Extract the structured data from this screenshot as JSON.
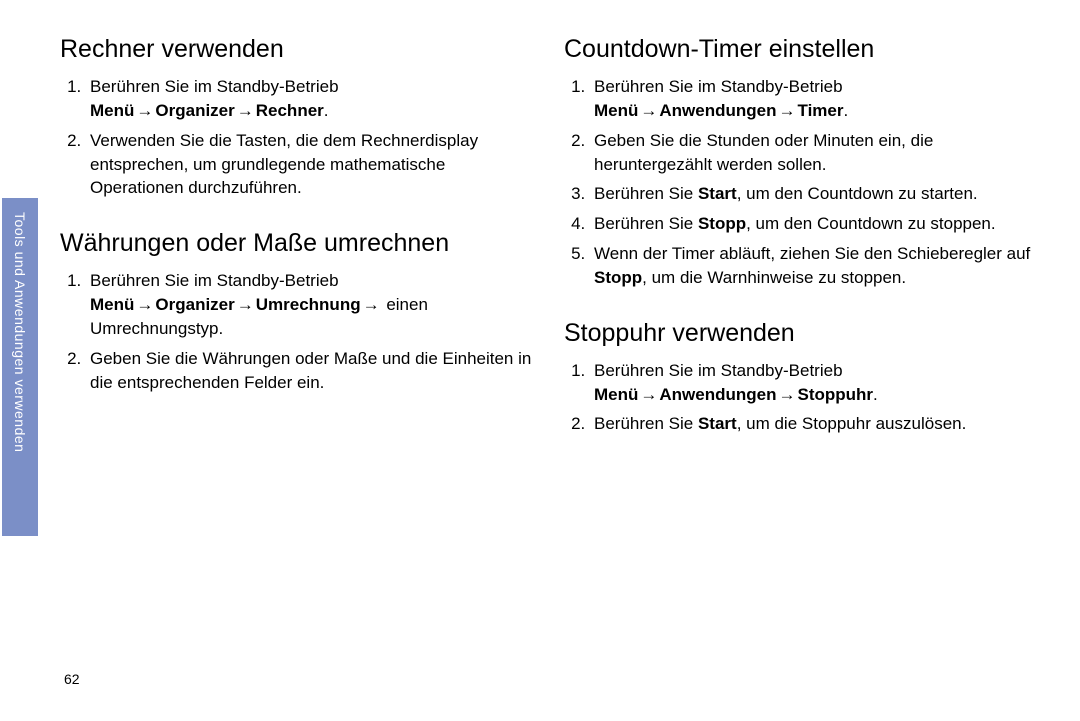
{
  "sidebar": {
    "label": "Tools und Anwendungen verwenden"
  },
  "page_number": "62",
  "arrow": "→",
  "left": {
    "section1": {
      "heading": "Rechner verwenden",
      "item1": {
        "pre": "Berühren Sie im Standby-Betrieb ",
        "b1": "Menü",
        "b2": "Organizer",
        "b3": "Rechner",
        "end": "."
      },
      "item2": "Verwenden Sie die Tasten, die dem Rechnerdisplay entsprechen, um grundlegende mathematische Operationen durchzuführen."
    },
    "section2": {
      "heading": "Währungen oder Maße umrechnen",
      "item1": {
        "pre": "Berühren Sie im Standby-Betrieb ",
        "b1": "Menü",
        "b2": "Organizer",
        "b3": "Umrechnung",
        "post": " einen Umrechnungstyp."
      },
      "item2": "Geben Sie die Währungen oder Maße und die Einheiten in die entsprechenden Felder ein."
    }
  },
  "right": {
    "section1": {
      "heading": "Countdown-Timer einstellen",
      "item1": {
        "pre": "Berühren Sie im Standby-Betrieb ",
        "b1": "Menü",
        "b2": "Anwendungen",
        "b3": "Timer",
        "end": "."
      },
      "item2": "Geben Sie die Stunden oder Minuten ein, die heruntergezählt werden sollen.",
      "item3": {
        "pre": "Berühren Sie ",
        "b1": "Start",
        "post": ", um den Countdown zu starten."
      },
      "item4": {
        "pre": "Berühren Sie ",
        "b1": "Stopp",
        "post": ", um den Countdown zu stoppen."
      },
      "item5": {
        "pre": "Wenn der Timer abläuft, ziehen Sie den Schieberegler auf ",
        "b1": "Stopp",
        "post": ", um die Warnhinweise zu stoppen."
      }
    },
    "section2": {
      "heading": "Stoppuhr verwenden",
      "item1": {
        "pre": "Berühren Sie im Standby-Betrieb ",
        "b1": "Menü",
        "b2": "Anwendungen",
        "b3": "Stoppuhr",
        "end": "."
      },
      "item2": {
        "pre": "Berühren Sie ",
        "b1": "Start",
        "post": ", um die Stoppuhr auszulösen."
      }
    }
  }
}
